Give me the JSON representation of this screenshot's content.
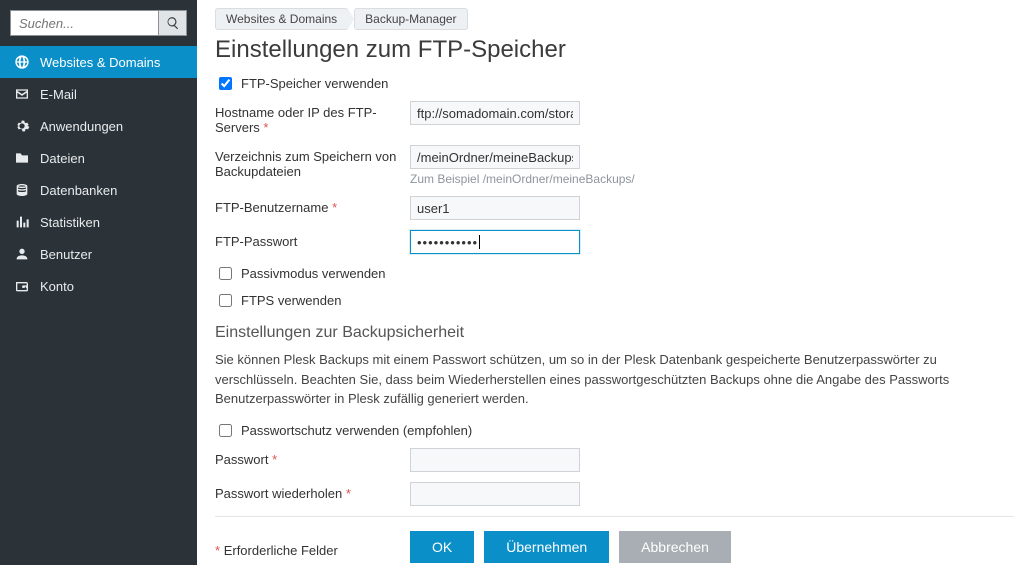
{
  "sidebar": {
    "search_placeholder": "Suchen...",
    "items": [
      {
        "label": "Websites & Domains",
        "icon": "globe",
        "active": true
      },
      {
        "label": "E-Mail",
        "icon": "mail",
        "active": false
      },
      {
        "label": "Anwendungen",
        "icon": "gear",
        "active": false
      },
      {
        "label": "Dateien",
        "icon": "folder",
        "active": false
      },
      {
        "label": "Datenbanken",
        "icon": "db",
        "active": false
      },
      {
        "label": "Statistiken",
        "icon": "stats",
        "active": false
      },
      {
        "label": "Benutzer",
        "icon": "user",
        "active": false
      },
      {
        "label": "Konto",
        "icon": "wallet",
        "active": false
      }
    ]
  },
  "breadcrumb": [
    "Websites & Domains",
    "Backup-Manager"
  ],
  "page_title": "Einstellungen zum FTP-Speicher",
  "form": {
    "use_ftp_label": "FTP-Speicher verwenden",
    "use_ftp_checked": true,
    "host_label": "Hostname oder IP des FTP-Servers",
    "host_required": true,
    "host_value": "ftp://somadomain.com/storage",
    "dir_label": "Verzeichnis zum Speichern von Backupdateien",
    "dir_value": "/meinOrdner/meineBackups/",
    "dir_helper": "Zum Beispiel /meinOrdner/meineBackups/",
    "user_label": "FTP-Benutzername",
    "user_required": true,
    "user_value": "user1",
    "pw_label": "FTP-Passwort",
    "pw_value": "•••••••••••",
    "passive_label": "Passivmodus verwenden",
    "passive_checked": false,
    "ftps_label": "FTPS verwenden",
    "ftps_checked": false
  },
  "security": {
    "heading": "Einstellungen zur Backupsicherheit",
    "desc": "Sie können Plesk Backups mit einem Passwort schützen, um so in der Plesk Datenbank gespeicherte Benutzerpasswörter zu verschlüsseln. Beachten Sie, dass beim Wiederherstellen eines passwortgeschützten Backups ohne die Angabe des Passworts Benutzerpasswörter in Plesk zufällig generiert werden.",
    "use_pw_label": "Passwortschutz verwenden (empfohlen)",
    "use_pw_checked": false,
    "pw_label": "Passwort",
    "pw_required": true,
    "pw2_label": "Passwort wiederholen",
    "pw2_required": true
  },
  "required_note": "Erforderliche Felder",
  "buttons": {
    "ok": "OK",
    "apply": "Übernehmen",
    "cancel": "Abbrechen"
  }
}
